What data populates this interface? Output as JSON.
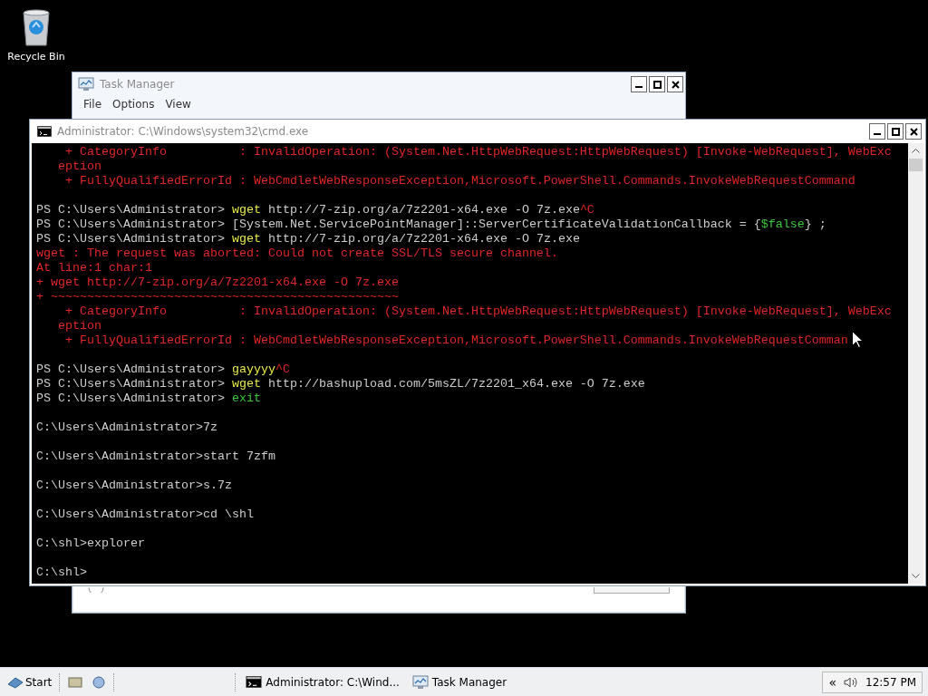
{
  "desktop": {
    "icons": [
      {
        "label": "Recycle Bin"
      }
    ]
  },
  "task_manager": {
    "title": "Task Manager",
    "menu": [
      "File",
      "Options",
      "View"
    ]
  },
  "console_window": {
    "title": "Administrator: C:\\Windows\\system32\\cmd.exe",
    "lines": [
      {
        "kind": "text",
        "segments": [
          {
            "kind": "error",
            "text": "    + CategoryInfo          : InvalidOperation: (System.Net.HttpWebRequest:HttpWebRequest) [Invoke-WebRequest], WebExc"
          }
        ]
      },
      {
        "kind": "text",
        "segments": [
          {
            "kind": "error",
            "text": "   eption"
          }
        ]
      },
      {
        "kind": "text",
        "segments": [
          {
            "kind": "error",
            "text": "    + FullyQualifiedErrorId : WebCmdletWebResponseException,Microsoft.PowerShell.Commands.InvokeWebRequestCommand"
          }
        ]
      },
      {
        "kind": "blank"
      },
      {
        "kind": "text",
        "segments": [
          {
            "kind": "plain",
            "text": "PS C:\\Users\\Administrator> "
          },
          {
            "kind": "command",
            "text": "wget"
          },
          {
            "kind": "plain",
            "text": " http://7-zip.org/a/7z2201-x64.exe -O 7z.exe"
          },
          {
            "kind": "error",
            "text": "^C"
          }
        ]
      },
      {
        "kind": "text",
        "segments": [
          {
            "kind": "plain",
            "text": "PS C:\\Users\\Administrator> [System.Net.ServicePointManager]::ServerCertificateValidationCallback = {"
          },
          {
            "kind": "literal",
            "text": "$false"
          },
          {
            "kind": "plain",
            "text": "} ;"
          }
        ]
      },
      {
        "kind": "text",
        "segments": [
          {
            "kind": "plain",
            "text": "PS C:\\Users\\Administrator> "
          },
          {
            "kind": "command",
            "text": "wget"
          },
          {
            "kind": "plain",
            "text": " http://7-zip.org/a/7z2201-x64.exe -O 7z.exe"
          }
        ]
      },
      {
        "kind": "text",
        "segments": [
          {
            "kind": "error",
            "text": "wget : The request was aborted: Could not create SSL/TLS secure channel."
          }
        ]
      },
      {
        "kind": "text",
        "segments": [
          {
            "kind": "error",
            "text": "At line:1 char:1"
          }
        ]
      },
      {
        "kind": "text",
        "segments": [
          {
            "kind": "error",
            "text": "+ wget http://7-zip.org/a/7z2201-x64.exe -O 7z.exe"
          }
        ]
      },
      {
        "kind": "text",
        "segments": [
          {
            "kind": "error",
            "text": "+ ~~~~~~~~~~~~~~~~~~~~~~~~~~~~~~~~~~~~~~~~~~~~~~~~"
          }
        ]
      },
      {
        "kind": "text",
        "segments": [
          {
            "kind": "error",
            "text": "    + CategoryInfo          : InvalidOperation: (System.Net.HttpWebRequest:HttpWebRequest) [Invoke-WebRequest], WebExc"
          }
        ]
      },
      {
        "kind": "text",
        "segments": [
          {
            "kind": "error",
            "text": "   eption"
          }
        ]
      },
      {
        "kind": "text",
        "segments": [
          {
            "kind": "error",
            "text": "    + FullyQualifiedErrorId : WebCmdletWebResponseException,Microsoft.PowerShell.Commands.InvokeWebRequestComman"
          }
        ]
      },
      {
        "kind": "blank"
      },
      {
        "kind": "text",
        "segments": [
          {
            "kind": "plain",
            "text": "PS C:\\Users\\Administrator> "
          },
          {
            "kind": "command",
            "text": "gayyyy"
          },
          {
            "kind": "error",
            "text": "^C"
          }
        ]
      },
      {
        "kind": "text",
        "segments": [
          {
            "kind": "plain",
            "text": "PS C:\\Users\\Administrator> "
          },
          {
            "kind": "command",
            "text": "wget"
          },
          {
            "kind": "plain",
            "text": " http://bashupload.com/5msZL/7z2201_x64.exe -O 7z.exe"
          }
        ]
      },
      {
        "kind": "text",
        "segments": [
          {
            "kind": "plain",
            "text": "PS C:\\Users\\Administrator> "
          },
          {
            "kind": "literal",
            "text": "exit"
          }
        ]
      },
      {
        "kind": "blank"
      },
      {
        "kind": "text",
        "segments": [
          {
            "kind": "plain",
            "text": "C:\\Users\\Administrator>7z"
          }
        ]
      },
      {
        "kind": "blank"
      },
      {
        "kind": "text",
        "segments": [
          {
            "kind": "plain",
            "text": "C:\\Users\\Administrator>start 7zfm"
          }
        ]
      },
      {
        "kind": "blank"
      },
      {
        "kind": "text",
        "segments": [
          {
            "kind": "plain",
            "text": "C:\\Users\\Administrator>s.7z"
          }
        ]
      },
      {
        "kind": "blank"
      },
      {
        "kind": "text",
        "segments": [
          {
            "kind": "plain",
            "text": "C:\\Users\\Administrator>cd \\shl"
          }
        ]
      },
      {
        "kind": "blank"
      },
      {
        "kind": "text",
        "segments": [
          {
            "kind": "plain",
            "text": "C:\\shl>explorer"
          }
        ]
      },
      {
        "kind": "blank"
      },
      {
        "kind": "text",
        "segments": [
          {
            "kind": "plain",
            "text": "C:\\shl>"
          }
        ]
      }
    ]
  },
  "taskbar": {
    "start": "Start",
    "tasks": [
      {
        "kind": "console",
        "label": "Administrator: C:\\Wind..."
      },
      {
        "kind": "monitor",
        "label": "Task Manager"
      }
    ],
    "tray_chevron": "«",
    "clock": "12:57 PM"
  }
}
